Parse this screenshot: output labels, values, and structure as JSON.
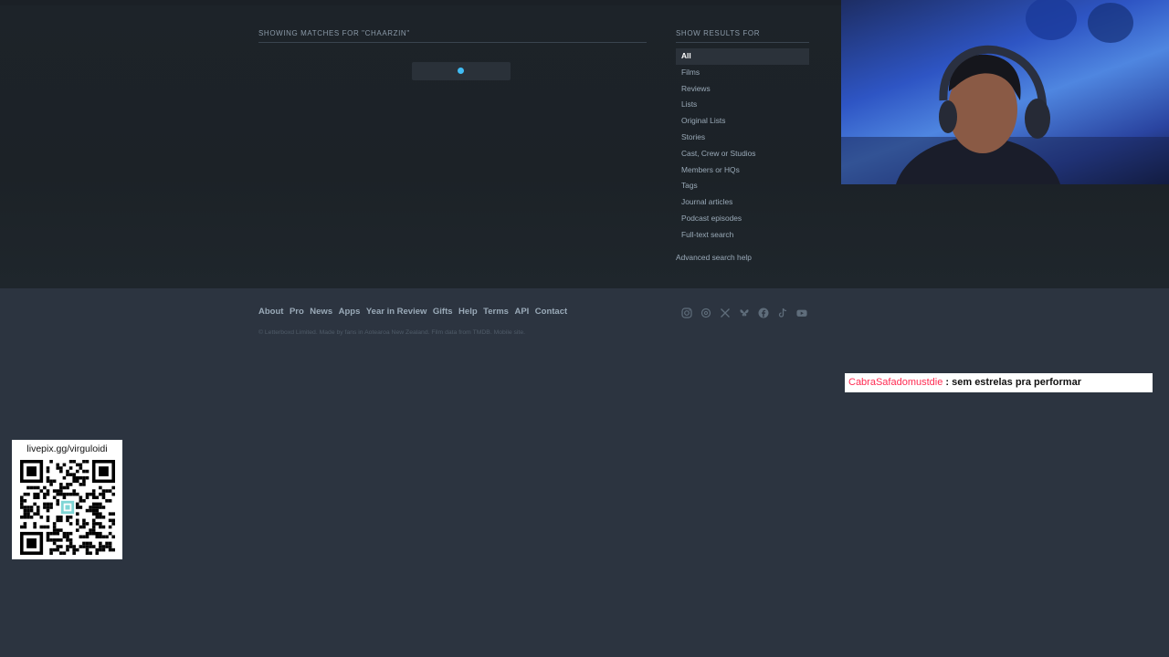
{
  "search": {
    "results_header": "SHOWING MATCHES FOR \"CHAARZIN\"",
    "loading": true
  },
  "sidebar": {
    "title": "SHOW RESULTS FOR",
    "filters": [
      {
        "label": "All",
        "active": true
      },
      {
        "label": "Films",
        "active": false
      },
      {
        "label": "Reviews",
        "active": false
      },
      {
        "label": "Lists",
        "active": false
      },
      {
        "label": "Original Lists",
        "active": false
      },
      {
        "label": "Stories",
        "active": false
      },
      {
        "label": "Cast, Crew or Studios",
        "active": false
      },
      {
        "label": "Members or HQs",
        "active": false
      },
      {
        "label": "Tags",
        "active": false
      },
      {
        "label": "Journal articles",
        "active": false
      },
      {
        "label": "Podcast episodes",
        "active": false
      },
      {
        "label": "Full-text search",
        "active": false
      }
    ],
    "advanced_help": "Advanced search help"
  },
  "footer": {
    "links": [
      "About",
      "Pro",
      "News",
      "Apps",
      "Year in Review",
      "Gifts",
      "Help",
      "Terms",
      "API",
      "Contact"
    ],
    "copyright": "© Letterboxd Limited. Made by fans in Aotearoa New Zealand. Film data from TMDB. Mobile site.",
    "social_icons": [
      "instagram-icon",
      "threads-icon",
      "x-icon",
      "bluesky-icon",
      "facebook-icon",
      "tiktok-icon",
      "youtube-icon"
    ]
  },
  "chat": {
    "message": {
      "user": "CabraSafadomustdie",
      "text": " : sem estrelas pra performar"
    }
  },
  "overlay": {
    "qr_label": "livepix.gg/virguloidi"
  },
  "colors": {
    "accent": "#40bcf4",
    "chat_user": "#ff2a51",
    "background": "#2c3440"
  }
}
